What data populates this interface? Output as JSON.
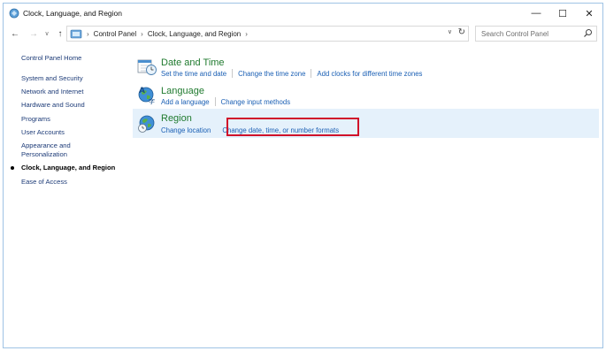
{
  "window": {
    "title": "Clock, Language, and Region",
    "minimize_glyph": "—",
    "maximize_glyph": "☐",
    "close_glyph": "✕"
  },
  "navigation": {
    "back_glyph": "←",
    "forward_glyph": "→",
    "history_glyph": "∨",
    "up_glyph": "↑",
    "breadcrumbs": [
      "Control Panel",
      "Clock, Language, and Region"
    ],
    "crumb_separator": "›",
    "dropdown_glyph": "∨",
    "refresh_glyph": "↻"
  },
  "search": {
    "placeholder": "Search Control Panel"
  },
  "left_pane": {
    "home": "Control Panel Home",
    "items": [
      "System and Security",
      "Network and Internet",
      "Hardware and Sound",
      "Programs",
      "User Accounts",
      "Appearance and Personalization",
      "Clock, Language, and Region",
      "Ease of Access"
    ],
    "appearance_line1": "Appearance and",
    "appearance_line2": "Personalization",
    "current": "Clock, Language, and Region"
  },
  "categories": [
    {
      "title": "Date and Time",
      "icon": "clock-calendar-icon",
      "links": [
        "Set the time and date",
        "Change the time zone",
        "Add clocks for different time zones"
      ]
    },
    {
      "title": "Language",
      "icon": "language-globe-icon",
      "links": [
        "Add a language",
        "Change input methods"
      ]
    },
    {
      "title": "Region",
      "icon": "region-globe-clock-icon",
      "links": [
        "Change location",
        "Change date, time, or number formats"
      ],
      "selected": true,
      "highlighted_link": "Change date, time, or number formats"
    }
  ],
  "colors": {
    "title_green": "#1f7a2e",
    "link_blue": "#1a5fb4",
    "left_link": "#1e3c78",
    "selected_bg": "#e5f1fb",
    "highlight_red": "#d0102a",
    "frame_border": "#9fc3e4"
  }
}
